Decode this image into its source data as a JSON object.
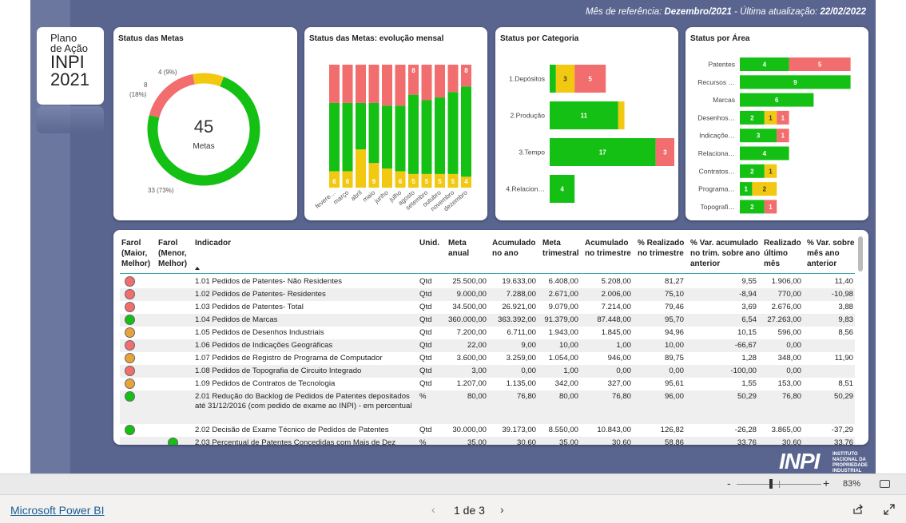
{
  "reference": {
    "prefix": "Mês de referência: ",
    "month": "Dezembro/2021",
    "middle": " - Última atualização: ",
    "date": "22/02/2022"
  },
  "logo": {
    "line1": "Plano",
    "line2": "de Ação",
    "line3": "INPI",
    "line4": "2021"
  },
  "colors": {
    "green": "#14c014",
    "red": "#f26d6d",
    "yellow": "#f2c811",
    "canvas": "#59648f"
  },
  "donut": {
    "title": "Status das Metas",
    "total": "45",
    "total_label": "Metas",
    "slices": [
      {
        "status": "green",
        "count": 33,
        "label": "33 (73%)"
      },
      {
        "status": "red",
        "count": 8,
        "label": "8\n(18%)"
      },
      {
        "status": "yellow",
        "count": 4,
        "label": "4 (9%)"
      }
    ]
  },
  "chart_data": [
    {
      "type": "bar",
      "title": "Status das Metas: evolução mensal",
      "categories": [
        "fevereiro",
        "março",
        "abril",
        "maio",
        "junho",
        "julho",
        "agosto",
        "setembro",
        "outubro",
        "novembro",
        "dezembro"
      ],
      "category_labels": [
        "fevere…",
        "março",
        "abril",
        "maio",
        "junho",
        "julho",
        "agosto",
        "setembro",
        "outubro",
        "novembro",
        "dezembro"
      ],
      "series": [
        {
          "status": "yellow",
          "values": [
            6,
            6,
            14,
            9,
            7,
            6,
            5,
            5,
            5,
            5,
            4
          ]
        },
        {
          "status": "green",
          "values": [
            25,
            25,
            17,
            22,
            23,
            24,
            29,
            27,
            28,
            30,
            33
          ]
        },
        {
          "status": "red",
          "values": [
            14,
            14,
            14,
            14,
            15,
            15,
            11,
            13,
            12,
            10,
            8
          ]
        }
      ],
      "labels": {
        "yellow": [
          "6",
          "6",
          "",
          "9",
          "",
          "6",
          "5",
          "5",
          "5",
          "5",
          "4"
        ],
        "red": [
          "",
          "",
          "",
          "",
          "",
          "",
          "8",
          "",
          "",
          "",
          "8"
        ]
      }
    },
    {
      "type": "bar",
      "orientation": "horizontal",
      "title": "Status por Categoria",
      "categories": [
        "1.Depósitos",
        "2.Produção",
        "3.Tempo",
        "4.Relacion…"
      ],
      "series": [
        {
          "status": "green",
          "values": [
            1,
            11,
            17,
            4
          ]
        },
        {
          "status": "yellow",
          "values": [
            3,
            1,
            0,
            0
          ]
        },
        {
          "status": "red",
          "values": [
            5,
            0,
            3,
            0
          ]
        }
      ],
      "labels": {
        "green": [
          "",
          "11",
          "17",
          "4"
        ],
        "yellow": [
          "3",
          "",
          "",
          ""
        ],
        "red": [
          "5",
          "",
          "3",
          ""
        ]
      },
      "xlim": [
        0,
        20
      ]
    },
    {
      "type": "bar",
      "orientation": "horizontal",
      "title": "Status por Área",
      "categories": [
        "Patentes",
        "Recursos …",
        "Marcas",
        "Desenhos…",
        "Indicaçõe…",
        "Relaciona…",
        "Contratos…",
        "Programa…",
        "Topografi…"
      ],
      "series": [
        {
          "status": "green",
          "values": [
            4,
            9,
            6,
            2,
            3,
            4,
            2,
            1,
            2
          ]
        },
        {
          "status": "yellow",
          "values": [
            0,
            0,
            0,
            1,
            0,
            0,
            1,
            2,
            0
          ]
        },
        {
          "status": "red",
          "values": [
            5,
            0,
            0,
            1,
            1,
            0,
            0,
            0,
            1
          ]
        }
      ],
      "labels": {
        "green": [
          "4",
          "9",
          "6",
          "2",
          "3",
          "4",
          "2",
          "1",
          "2"
        ],
        "yellow": [
          "",
          "",
          "",
          "1",
          "",
          "",
          "1",
          "2",
          ""
        ],
        "red": [
          "5",
          "",
          "",
          "1",
          "1",
          "",
          "",
          "",
          "1"
        ]
      },
      "xlim": [
        0,
        9
      ]
    }
  ],
  "table": {
    "headers": {
      "farol_maior": "Farol (Maior, Melhor)",
      "farol_menor": "Farol (Menor, Melhor)",
      "indicador": "Indicador",
      "unid": "Unid.",
      "meta_anual": "Meta anual",
      "acum_ano": "Acumulado no ano",
      "meta_tri": "Meta trimestral",
      "acum_tri": "Acumulado no trimestre",
      "real_tri": "% Realizado no trimestre",
      "var_acum": "% Var. acumulado no trim. sobre ano anterior",
      "real_mes": "Realizado último mês",
      "var_mes": "% Var. sobre mês ano anterior"
    },
    "rows": [
      {
        "f1": "red",
        "f2": "",
        "ind": "1.01 Pedidos de Patentes- Não Residentes",
        "u": "Qtd",
        "ma": "25.500,00",
        "aa": "19.633,00",
        "mt": "6.408,00",
        "at": "5.208,00",
        "rt": "81,27",
        "va": "9,55",
        "rm": "1.906,00",
        "vm": "11,40"
      },
      {
        "f1": "red",
        "f2": "",
        "ind": "1.02 Pedidos de Patentes- Residentes",
        "u": "Qtd",
        "ma": "9.000,00",
        "aa": "7.288,00",
        "mt": "2.671,00",
        "at": "2.006,00",
        "rt": "75,10",
        "va": "-8,94",
        "rm": "770,00",
        "vm": "-10,98"
      },
      {
        "f1": "red",
        "f2": "",
        "ind": "1.03 Pedidos de Patentes- Total",
        "u": "Qtd",
        "ma": "34.500,00",
        "aa": "26.921,00",
        "mt": "9.079,00",
        "at": "7.214,00",
        "rt": "79,46",
        "va": "3,69",
        "rm": "2.676,00",
        "vm": "3,88"
      },
      {
        "f1": "green",
        "f2": "",
        "ind": "1.04 Pedidos de Marcas",
        "u": "Qtd",
        "ma": "360.000,00",
        "aa": "363.392,00",
        "mt": "91.379,00",
        "at": "87.448,00",
        "rt": "95,70",
        "va": "6,54",
        "rm": "27.263,00",
        "vm": "9,83"
      },
      {
        "f1": "orange",
        "f2": "",
        "ind": "1.05 Pedidos de Desenhos Industriais",
        "u": "Qtd",
        "ma": "7.200,00",
        "aa": "6.711,00",
        "mt": "1.943,00",
        "at": "1.845,00",
        "rt": "94,96",
        "va": "10,15",
        "rm": "596,00",
        "vm": "8,56"
      },
      {
        "f1": "red",
        "f2": "",
        "ind": "1.06 Pedidos de Indicações Geográficas",
        "u": "Qtd",
        "ma": "22,00",
        "aa": "9,00",
        "mt": "10,00",
        "at": "1,00",
        "rt": "10,00",
        "va": "-66,67",
        "rm": "0,00",
        "vm": ""
      },
      {
        "f1": "orange",
        "f2": "",
        "ind": "1.07 Pedidos de Registro de Programa de Computador",
        "u": "Qtd",
        "ma": "3.600,00",
        "aa": "3.259,00",
        "mt": "1.054,00",
        "at": "946,00",
        "rt": "89,75",
        "va": "1,28",
        "rm": "348,00",
        "vm": "11,90"
      },
      {
        "f1": "red",
        "f2": "",
        "ind": "1.08 Pedidos de Topografia de Circuito Integrado",
        "u": "Qtd",
        "ma": "3,00",
        "aa": "0,00",
        "mt": "1,00",
        "at": "0,00",
        "rt": "0,00",
        "va": "-100,00",
        "rm": "0,00",
        "vm": ""
      },
      {
        "f1": "orange",
        "f2": "",
        "ind": "1.09 Pedidos de Contratos de Tecnologia",
        "u": "Qtd",
        "ma": "1.207,00",
        "aa": "1.135,00",
        "mt": "342,00",
        "at": "327,00",
        "rt": "95,61",
        "va": "1,55",
        "rm": "153,00",
        "vm": "8,51"
      },
      {
        "f1": "green",
        "f2": "",
        "ind": "2.01 Redução do Backlog de Pedidos de Patentes depositados até 31/12/2016 (com pedido de exame ao INPI) - em percentual",
        "u": "%",
        "ma": "80,00",
        "aa": "76,80",
        "mt": "80,00",
        "at": "76,80",
        "rt": "96,00",
        "va": "50,29",
        "rm": "76,80",
        "vm": "50,29"
      },
      {
        "f1": "green",
        "f2": "",
        "ind": "2.02 Decisão de Exame Técnico de Pedidos de Patentes",
        "u": "Qtd",
        "ma": "30.000,00",
        "aa": "39.173,00",
        "mt": "8.550,00",
        "at": "10.843,00",
        "rt": "126,82",
        "va": "-26,28",
        "rm": "3.865,00",
        "vm": "-37,29"
      },
      {
        "f1": "",
        "f2": "green",
        "ind": "2.03 Percentual de Patentes Concedidas com Mais de Dez",
        "u": "%",
        "ma": "35,00",
        "aa": "30,60",
        "mt": "35,00",
        "at": "30,60",
        "rt": "58,86",
        "va": "33,76",
        "rm": "30,60",
        "vm": "33,76"
      }
    ]
  },
  "footer": {
    "brand": "Microsoft Power BI",
    "page": "1 de 3",
    "zoom": "83%",
    "zoom_value": 83
  },
  "inpi_logo": {
    "big": "INPI",
    "l1": "INSTITUTO",
    "l2": "NACIONAL DA",
    "l3": "PROPRIEDADE",
    "l4": "INDUSTRIAL"
  }
}
